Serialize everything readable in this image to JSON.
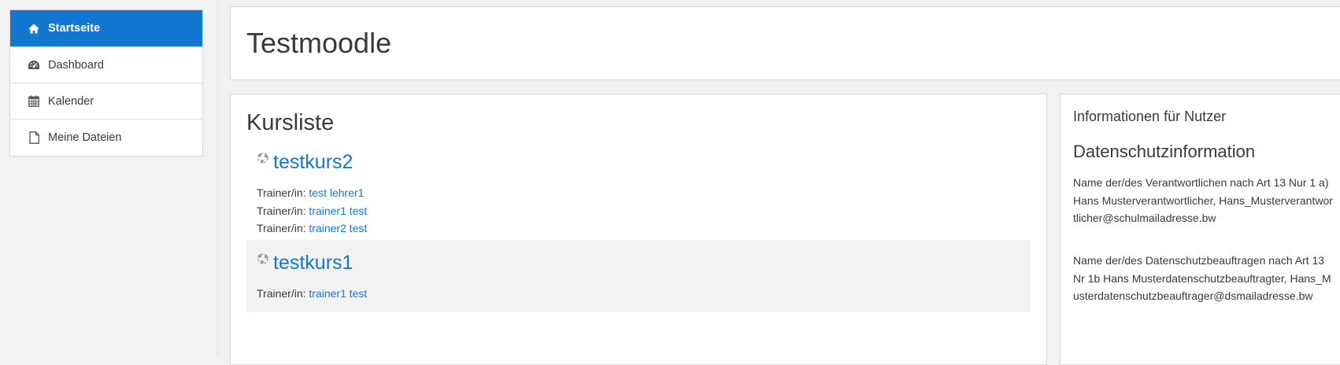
{
  "nav": {
    "items": [
      {
        "label": "Startseite",
        "icon": "home-icon",
        "active": true
      },
      {
        "label": "Dashboard",
        "icon": "dashboard-icon",
        "active": false
      },
      {
        "label": "Kalender",
        "icon": "calendar-icon",
        "active": false
      },
      {
        "label": "Meine Dateien",
        "icon": "file-icon",
        "active": false
      }
    ]
  },
  "header": {
    "title": "Testmoodle"
  },
  "courses": {
    "heading": "Kursliste",
    "items": [
      {
        "name": "testkurs2",
        "teachers": [
          {
            "role": "Trainer/in: ",
            "name": "test lehrer1"
          },
          {
            "role": "Trainer/in: ",
            "name": "trainer1 test"
          },
          {
            "role": "Trainer/in: ",
            "name": "trainer2 test"
          }
        ]
      },
      {
        "name": "testkurs1",
        "teachers": [
          {
            "role": "Trainer/in: ",
            "name": "trainer1 test"
          }
        ]
      }
    ]
  },
  "info_block": {
    "title": "Informationen für Nutzer",
    "subtitle": "Datenschutzinformation",
    "paragraphs": [
      "Name der/des Verantwortlichen nach Art 13 Nur 1 a) Hans Musterverantwortlicher, Hans_Musterverantwortlicher@schulmailadresse.bw",
      "Name der/des Datenschutzbeauftragen nach Art 13 Nr 1b Hans Musterdatenschutzbeauftragter, Hans_Musterdatenschutzbeauftrager@dsmailadresse.bw"
    ]
  },
  "colors": {
    "accent": "#1177d1",
    "text": "#373a3c",
    "page_bg": "#f2f2f2"
  }
}
